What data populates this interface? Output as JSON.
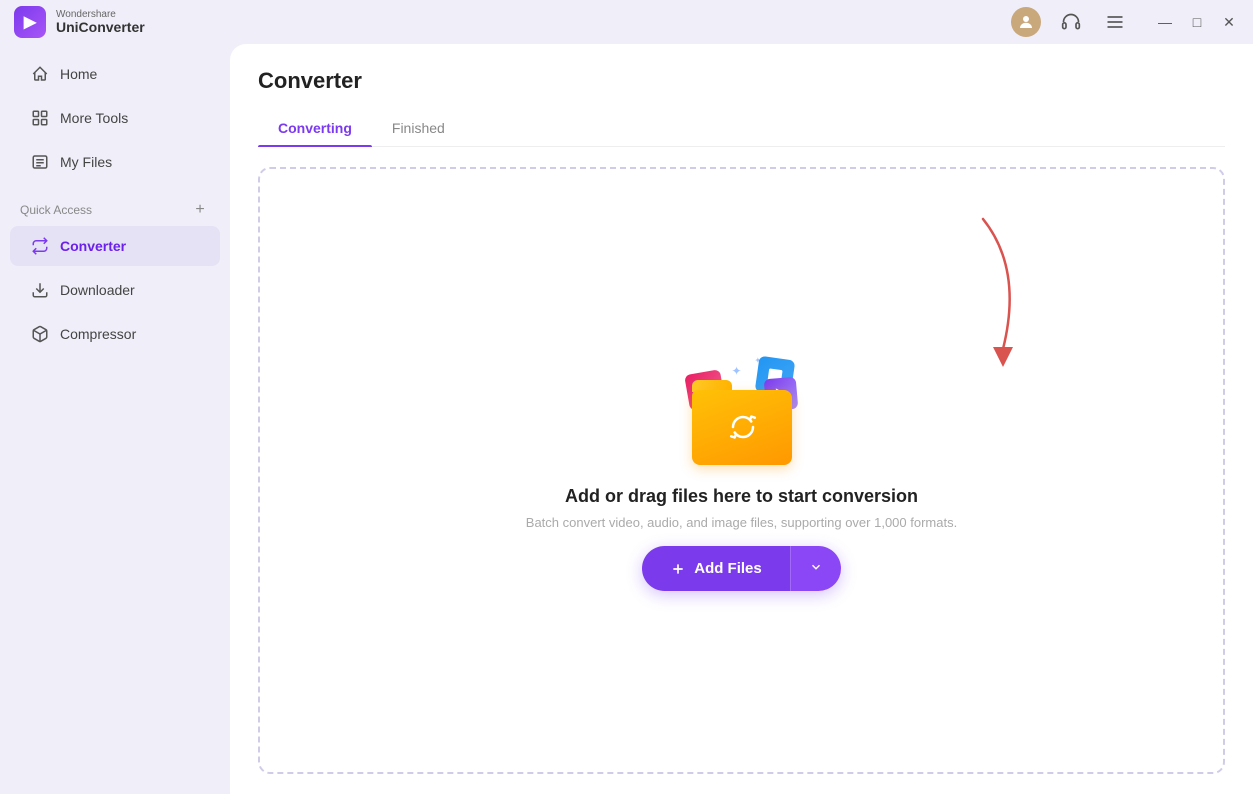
{
  "app": {
    "name_top": "Wondershare",
    "name_bottom": "UniConverter",
    "logo_char": "▶"
  },
  "titlebar": {
    "icons": {
      "avatar": "👤",
      "headphones": "🎧",
      "menu": "☰"
    },
    "window_controls": {
      "minimize": "—",
      "maximize": "□",
      "close": "✕"
    }
  },
  "sidebar": {
    "nav_items": [
      {
        "id": "home",
        "label": "Home",
        "icon": "⌂"
      },
      {
        "id": "more-tools",
        "label": "More Tools",
        "icon": "⊞"
      },
      {
        "id": "my-files",
        "label": "My Files",
        "icon": "📋"
      }
    ],
    "quick_access_label": "Quick Access",
    "quick_access_add": "+",
    "quick_access_items": [
      {
        "id": "converter",
        "label": "Converter",
        "icon": "🔄",
        "active": true
      },
      {
        "id": "downloader",
        "label": "Downloader",
        "icon": "📥"
      },
      {
        "id": "compressor",
        "label": "Compressor",
        "icon": "📦"
      }
    ]
  },
  "content": {
    "title": "Converter",
    "tabs": [
      {
        "id": "converting",
        "label": "Converting",
        "active": true
      },
      {
        "id": "finished",
        "label": "Finished",
        "active": false
      }
    ],
    "drop_zone": {
      "main_text": "Add or drag files here to start conversion",
      "sub_text": "Batch convert video, audio, and image files, supporting over 1,000 formats.",
      "add_files_label": "+ Add Files",
      "add_files_plus": "+",
      "dropdown_arrow": "▾"
    }
  }
}
